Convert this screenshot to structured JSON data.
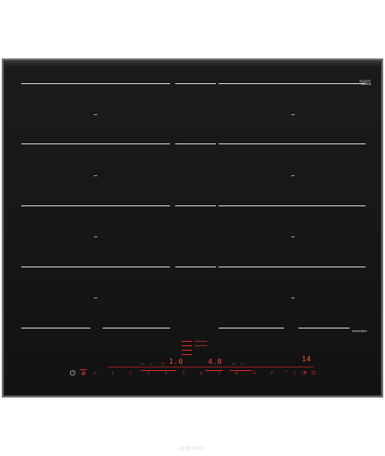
{
  "appliance": {
    "brand": "BOSCH",
    "top_right_badge": "SCHOTT\nCERAN",
    "top_right_sub": "",
    "top_left_tag": "",
    "cooking_type": "induction",
    "flex_label_left": "",
    "flex_label_right": ""
  },
  "controls": {
    "left_display": "1.0",
    "center_display": "4.0",
    "right_display": "14",
    "power_slider": [
      "0",
      "1",
      "2",
      "3",
      "4",
      "5",
      "6",
      "7",
      "8",
      "9",
      "P"
    ],
    "colors": {
      "accent_red": "#e5322d",
      "panel": "#161616",
      "frame": "#6f6f6f"
    }
  },
  "icons": {
    "power": "power-icon",
    "lock": "child-lock-icon",
    "timer": "timer-icon",
    "flex": "flex-zone-icon",
    "wipe": "wipe-protect-icon",
    "fry": "fry-sensor-icon",
    "boost": "power-boost-icon",
    "program": "program-icon"
  }
}
